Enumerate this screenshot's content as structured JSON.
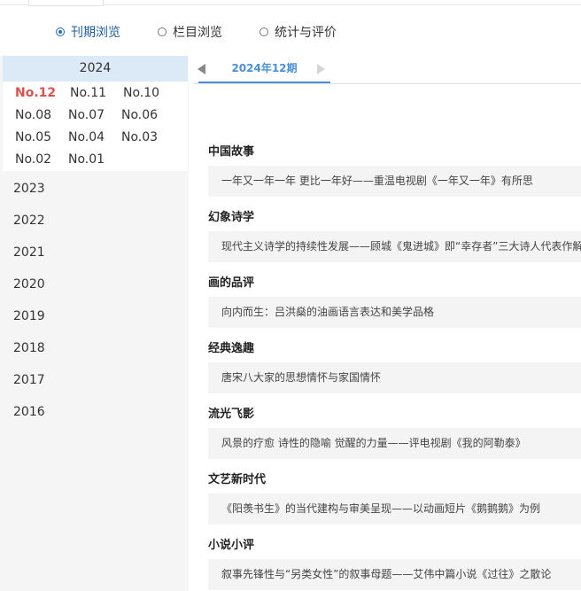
{
  "nav": {
    "options": [
      {
        "label": "刊期浏览",
        "selected": true
      },
      {
        "label": "栏目浏览",
        "selected": false
      },
      {
        "label": "统计与评价",
        "selected": false
      }
    ]
  },
  "sidebar": {
    "current_year": "2024",
    "issues": [
      "No.12",
      "No.11",
      "No.10",
      "No.08",
      "No.07",
      "No.06",
      "No.05",
      "No.04",
      "No.03",
      "No.02",
      "No.01"
    ],
    "selected_issue": "No.12",
    "years": [
      "2023",
      "2022",
      "2021",
      "2020",
      "2019",
      "2018",
      "2017",
      "2016"
    ]
  },
  "issue_tab": {
    "label": "2024年12期"
  },
  "colors": {
    "accent": "#4a90d9",
    "selected_issue": "#d9534f",
    "year_highlight": "#dceaf7"
  },
  "sections": [
    {
      "title": "中国故事",
      "articles": [
        "一年又一年一年 更比一年好——重温电视剧《一年又一年》有所思"
      ]
    },
    {
      "title": "幻象诗学",
      "articles": [
        "现代主义诗学的持续性发展——顾城《鬼进城》即“幸存者”三大诗人代表作解"
      ]
    },
    {
      "title": "画的品评",
      "articles": [
        "向内而生：吕洪燊的油画语言表达和美学品格"
      ]
    },
    {
      "title": "经典逸趣",
      "articles": [
        "唐宋八大家的思想情怀与家国情怀"
      ]
    },
    {
      "title": "流光飞影",
      "articles": [
        "风景的疗愈 诗性的隐喻 觉醒的力量——评电视剧《我的阿勒泰》"
      ]
    },
    {
      "title": "文艺新时代",
      "articles": [
        "《阳羡书生》的当代建构与审美呈现——以动画短片《鹅鹅鹅》为例"
      ]
    },
    {
      "title": "小说小评",
      "articles": [
        "叙事先锋性与“另类女性”的叙事母题——艾伟中篇小说《过往》之散论"
      ]
    }
  ]
}
